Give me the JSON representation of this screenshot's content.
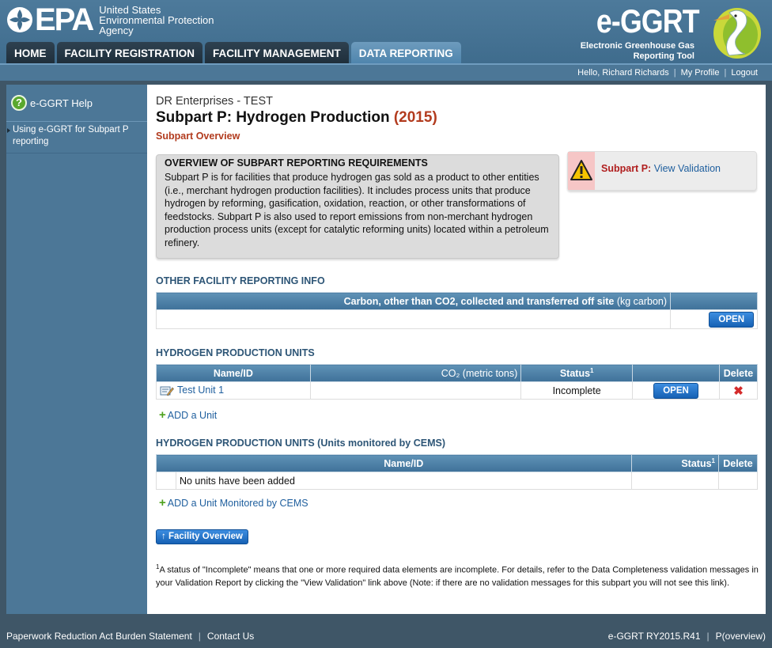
{
  "header": {
    "epa_word": "EPA",
    "agency_line1": "United States",
    "agency_line2": "Environmental Protection",
    "agency_line3": "Agency",
    "app_title": "e-GGRT",
    "app_subtitle_line1": "Electronic Greenhouse Gas",
    "app_subtitle_line2": "Reporting Tool"
  },
  "tabs": [
    {
      "label": "HOME"
    },
    {
      "label": "FACILITY REGISTRATION"
    },
    {
      "label": "FACILITY MANAGEMENT"
    },
    {
      "label": "DATA REPORTING",
      "active": true
    }
  ],
  "userbar": {
    "greeting": "Hello, Richard Richards",
    "profile": "My Profile",
    "logout": "Logout"
  },
  "sidebar": {
    "help_title": "e-GGRT Help",
    "help_link": "Using e-GGRT for Subpart P reporting"
  },
  "main": {
    "company": "DR Enterprises - TEST",
    "title": "Subpart P: Hydrogen Production",
    "year": "(2015)",
    "subtitle": "Subpart Overview",
    "overview_heading": "OVERVIEW OF SUBPART REPORTING REQUIREMENTS",
    "overview_text": "Subpart P is for facilities that produce hydrogen gas sold as a product to other entities (i.e., merchant hydrogen production facilities). It includes process units that produce hydrogen by reforming, gasification, oxidation, reaction, or other transformations of feedstocks. Subpart P is also used to report emissions from non-merchant hydrogen production process units (except for catalytic reforming units) located within a petroleum refinery.",
    "validation_label": "Subpart P:",
    "validation_link": "View Validation"
  },
  "other_info": {
    "title": "OTHER FACILITY REPORTING INFO",
    "col_header_bold": "Carbon, other than CO2, collected and transferred off site",
    "col_header_unit": "(kg carbon)",
    "open_label": "OPEN"
  },
  "units": {
    "title": "HYDROGEN PRODUCTION UNITS",
    "headers": {
      "name": "Name/ID",
      "co2": "CO₂ (metric tons)",
      "status": "Status",
      "status_sup": "1",
      "delete": "Delete"
    },
    "rows": [
      {
        "name": "Test Unit 1",
        "co2": "",
        "status": "Incomplete",
        "open": "OPEN"
      }
    ],
    "add_label": "ADD a Unit"
  },
  "cems": {
    "title": "HYDROGEN PRODUCTION UNITS (Units monitored by CEMS)",
    "headers": {
      "name": "Name/ID",
      "status": "Status",
      "status_sup": "1",
      "delete": "Delete"
    },
    "empty_text": "No units have been added",
    "add_label": "ADD a Unit Monitored by CEMS"
  },
  "facility_button": "Facility Overview",
  "footnote": {
    "sup": "1",
    "text": "A status of \"Incomplete\" means that one or more required data elements are incomplete. For details, refer to the Data Completeness validation messages in your Validation Report by clicking the \"View Validation\" link above (Note: if there are no validation messages for this subpart you will not see this link)."
  },
  "footer": {
    "paperwork": "Paperwork Reduction Act Burden Statement",
    "contact": "Contact Us",
    "version": "e-GGRT RY2015.R41",
    "page_code": "P(overview)"
  }
}
